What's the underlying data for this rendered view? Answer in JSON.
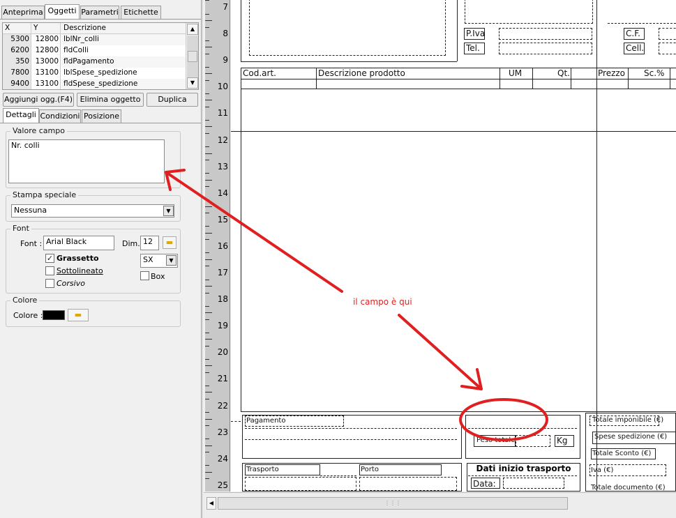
{
  "tabs_top": [
    "Anteprima",
    "Oggetti",
    "Parametri",
    "Etichette"
  ],
  "grid": {
    "headers": [
      "X",
      "Y",
      "Descrizione"
    ],
    "rows": [
      {
        "x": "5300",
        "y": "12800",
        "desc": "lblNr_colli"
      },
      {
        "x": "6200",
        "y": "12800",
        "desc": "fldColli"
      },
      {
        "x": "350",
        "y": "13000",
        "desc": "fldPagamento"
      },
      {
        "x": "7800",
        "y": "13100",
        "desc": "lblSpese_spedizione"
      },
      {
        "x": "9400",
        "y": "13100",
        "desc": "fldSpese_spedizione"
      }
    ]
  },
  "buttons": {
    "add": "Aggiungi ogg.(F4)",
    "delete": "Elimina oggetto",
    "duplicate": "Duplica"
  },
  "tabs_detail": [
    "Dettagli",
    "Condizioni",
    "Posizione"
  ],
  "valore_campo": {
    "label": "Valore campo",
    "value": "Nr. colli"
  },
  "stampa_speciale": {
    "label": "Stampa speciale",
    "value": "Nessuna"
  },
  "font": {
    "label": "Font",
    "font_label": "Font :",
    "font_value": "Arial Black",
    "dim_label": "Dim.",
    "dim_value": "12",
    "align_value": "SX",
    "bold": "Grassetto",
    "underline": "Sottolineato",
    "italic": "Corsivo",
    "box": "Box"
  },
  "colore": {
    "label": "Colore",
    "color_label": "Colore :",
    "swatch": "#000000"
  },
  "ruler": [
    "7",
    "8",
    "9",
    "10",
    "11",
    "12",
    "13",
    "14",
    "15",
    "16",
    "17",
    "18",
    "19",
    "20",
    "21",
    "22",
    "23",
    "24",
    "25"
  ],
  "report": {
    "piva": "P.Iva",
    "tel": "Tel.",
    "cf": "C.F.",
    "cell": "Cell.",
    "col_codart": "Cod.art.",
    "col_desc": "Descrizione prodotto",
    "col_um": "UM",
    "col_qt": "Qt.",
    "col_prezzo": "Prezzo",
    "col_sc": "Sc.%",
    "pagamento": "Pagamento",
    "peso_totale": "Peso totale",
    "kg": "Kg",
    "totale_imponibile": "Totale imponibile (€)",
    "spese_spedizione": "Spese spedizione (€)",
    "totale_sconto": "Totale Sconto (€)",
    "iva": "Iva (€)",
    "totale_documento": "Totale documento (€)",
    "trasporto": "Trasporto",
    "porto": "Porto",
    "dati_inizio": "Dati inizio trasporto",
    "data": "Data:"
  },
  "annotation": {
    "text": "il campo è qui",
    "color": "#e02020"
  }
}
